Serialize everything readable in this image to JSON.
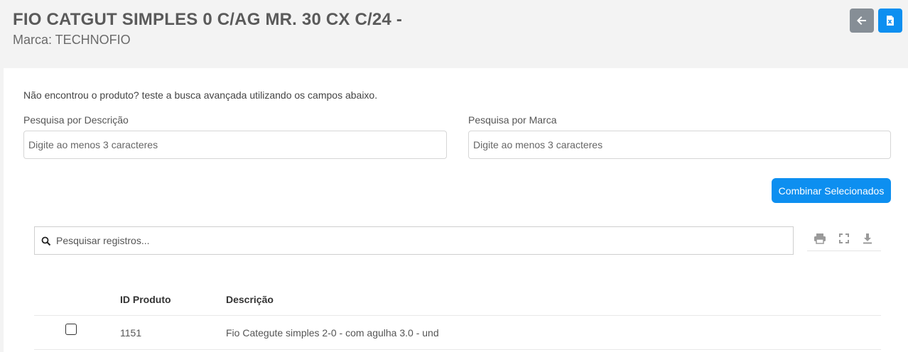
{
  "header": {
    "title": "FIO CATGUT SIMPLES 0 C/AG MR. 30 CX C/24 -",
    "subtitle": "Marca: TECHNOFIO",
    "buttons": [
      {
        "icon": "arrow-left-icon",
        "color": "#868e96"
      },
      {
        "icon": "excel-icon",
        "color": "#0d8ff0"
      }
    ]
  },
  "search_form": {
    "hint": "Não encontrou o produto? teste a busca avançada utilizando os campos abaixo.",
    "description_label": "Pesquisa por Descrição",
    "description_placeholder": "Digite ao menos 3 caracteres",
    "brand_label": "Pesquisa por Marca",
    "brand_placeholder": "Digite ao menos 3 caracteres",
    "combine_button": "Combinar Selecionados"
  },
  "table": {
    "search_placeholder": "Pesquisar registros...",
    "tools": [
      "print-icon",
      "fullscreen-icon",
      "download-icon"
    ],
    "columns": [
      "ID Produto",
      "Descrição"
    ],
    "rows": [
      {
        "id": "1151",
        "description": "Fio Categute simples 2-0 - com agulha 3.0 - und",
        "checked": false
      }
    ]
  },
  "colors": {
    "primary": "#0d8ff0",
    "secondary": "#868e96",
    "background": "#f3f3f3"
  }
}
